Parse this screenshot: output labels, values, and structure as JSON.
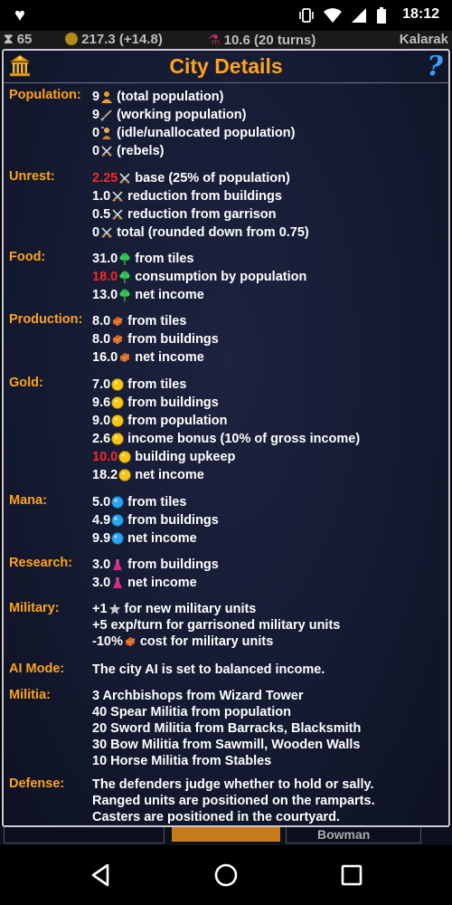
{
  "status": {
    "time": "18:12"
  },
  "resources": {
    "units": "65",
    "gold": "217.3 (+14.8)",
    "research": "10.6 (20 turns)",
    "city": "Kalarak"
  },
  "header": {
    "title": "City Details",
    "help": "?"
  },
  "sections": {
    "population": {
      "label": "Population:",
      "lines": [
        {
          "value": "9",
          "icon": "person-icon",
          "text": "(total population)"
        },
        {
          "value": "9",
          "icon": "shovel-icon",
          "text": "(working population)"
        },
        {
          "value": "0",
          "icon": "idle-worker-icon",
          "text": "(idle/unallocated population)"
        },
        {
          "value": "0",
          "icon": "crossed-swords-icon",
          "text": "(rebels)"
        }
      ]
    },
    "unrest": {
      "label": "Unrest:",
      "lines": [
        {
          "value": "2.25",
          "red": true,
          "icon": "crossed-swords-icon",
          "text": "base (25% of population)"
        },
        {
          "value": "1.0",
          "icon": "crossed-swords-icon",
          "text": "reduction from buildings"
        },
        {
          "value": "0.5",
          "icon": "crossed-swords-icon",
          "text": "reduction from garrison"
        },
        {
          "value": "0",
          "icon": "crossed-swords-icon",
          "text": "total (rounded down from 0.75)"
        }
      ]
    },
    "food": {
      "label": "Food:",
      "lines": [
        {
          "value": "31.0",
          "icon": "food-icon",
          "text": "from tiles"
        },
        {
          "value": "18.0",
          "red": true,
          "icon": "food-icon",
          "text": "consumption by population"
        },
        {
          "value": "13.0",
          "icon": "food-icon",
          "text": "net income"
        }
      ]
    },
    "production": {
      "label": "Production:",
      "lines": [
        {
          "value": "8.0",
          "icon": "production-icon",
          "text": "from tiles"
        },
        {
          "value": "8.0",
          "icon": "production-icon",
          "text": "from buildings"
        },
        {
          "value": "16.0",
          "icon": "production-icon",
          "text": "net income"
        }
      ]
    },
    "gold": {
      "label": "Gold:",
      "lines": [
        {
          "value": "7.0",
          "icon": "gold-coin-icon",
          "text": "from tiles"
        },
        {
          "value": "9.6",
          "icon": "gold-coin-icon",
          "text": "from buildings"
        },
        {
          "value": "9.0",
          "icon": "gold-coin-icon",
          "text": "from population"
        },
        {
          "value": "2.6",
          "icon": "gold-coin-icon",
          "text": "income bonus (10% of gross income)"
        },
        {
          "value": "10.0",
          "red": true,
          "icon": "gold-coin-icon",
          "text": "building upkeep"
        },
        {
          "value": "18.2",
          "icon": "gold-coin-icon",
          "text": "net income"
        }
      ]
    },
    "mana": {
      "label": "Mana:",
      "lines": [
        {
          "value": "5.0",
          "icon": "mana-orb-icon",
          "text": "from tiles"
        },
        {
          "value": "4.9",
          "icon": "mana-orb-icon",
          "text": "from buildings"
        },
        {
          "value": "9.9",
          "icon": "mana-orb-icon",
          "text": "net income"
        }
      ]
    },
    "research": {
      "label": "Research:",
      "lines": [
        {
          "value": "3.0",
          "icon": "research-flask-icon",
          "text": "from buildings"
        },
        {
          "value": "3.0",
          "icon": "research-flask-icon",
          "text": "net income"
        }
      ]
    },
    "military": {
      "label": "Military:",
      "lines": [
        {
          "value": "+1",
          "icon": "star-icon",
          "text": "for new military units"
        },
        {
          "value": "",
          "icon": "",
          "text": "+5 exp/turn for garrisoned military units"
        },
        {
          "value": "-10%",
          "icon": "production-icon",
          "text": "cost for military units"
        }
      ]
    },
    "ai": {
      "label": "AI Mode:",
      "lines": [
        {
          "value": "",
          "icon": "",
          "text": "The city AI is set to balanced income."
        }
      ]
    },
    "militia": {
      "label": "Militia:",
      "lines": [
        {
          "value": "",
          "icon": "",
          "text": "3 Archbishops from Wizard Tower"
        },
        {
          "value": "",
          "icon": "",
          "text": "40 Spear Militia from population"
        },
        {
          "value": "",
          "icon": "",
          "text": "20 Sword Militia from Barracks, Blacksmith"
        },
        {
          "value": "",
          "icon": "",
          "text": "30 Bow Militia from Sawmill, Wooden Walls"
        },
        {
          "value": "",
          "icon": "",
          "text": "10 Horse Militia from Stables"
        }
      ]
    },
    "defense": {
      "label": "Defense:",
      "lines": [
        {
          "value": "",
          "icon": "",
          "text": "The defenders judge whether to hold or sally."
        },
        {
          "value": "",
          "icon": "",
          "text": "Ranged units are positioned on the ramparts."
        },
        {
          "value": "",
          "icon": "",
          "text": "Casters are positioned in the courtyard."
        }
      ]
    }
  },
  "bottom_tab": {
    "label": "Bowman"
  }
}
